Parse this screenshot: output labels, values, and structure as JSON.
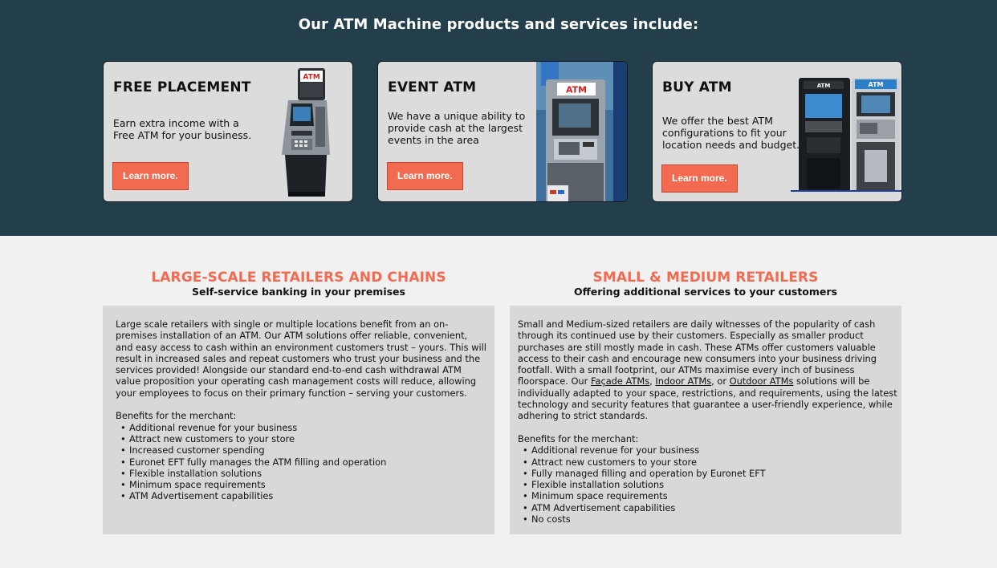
{
  "banner": {
    "heading": "Our ATM Machine products and services include:"
  },
  "cards": [
    {
      "title": "FREE PLACEMENT",
      "description": "Earn extra income with a Free ATM for your business.",
      "button": "Learn more.",
      "image_label": "ATM"
    },
    {
      "title": "EVENT ATM",
      "description": "We have a unique ability to provide cash at the largest events in the area",
      "button": "Learn more.",
      "image_label": "ATM"
    },
    {
      "title": "BUY ATM",
      "description": "We offer the best ATM configurations  to fit your location needs and budget.",
      "button": "Learn more.",
      "image_label_1": "ATM",
      "image_label_2": "ATM"
    }
  ],
  "large": {
    "title": "LARGE-SCALE RETAILERS AND CHAINS",
    "subtitle": "Self-service banking in your premises",
    "paragraph": "Large scale retailers with single or multiple locations benefit from an on-premises installation of an ATM. Our ATM solutions offer reliable, convenient, and easy access to cash within an environment customers trust – yours. This will result in increased sales and repeat customers who trust your business and the services provided! Alongside our standard end-to-end cash withdrawal ATM value proposition your operating cash management costs will reduce, allowing your employees to focus on their primary function – serving your  customers.",
    "benefits_heading": "Benefits for the merchant:",
    "benefits": [
      "Additional revenue for your business",
      "Attract new customers to your store",
      "Increased customer spending",
      "Euronet EFT fully manages the ATM filling and operation",
      "Flexible installation solutions",
      "Minimum space requirements",
      "ATM Advertisement capabilities"
    ]
  },
  "small": {
    "title": "SMALL & MEDIUM RETAILERS",
    "subtitle": "Offering additional services to your customers",
    "paragraph_start": "Small and Medium-sized retailers are daily witnesses of the popularity of cash through its continued use by their customers. Especially as smaller product purchases are still mostly made in cash. These ATMs offer customers valuable access to their cash and encourage new consumers into your business driving footfall. With a small footprint, our ATMs maximise every inch of business floorspace. Our ",
    "link_facade": "Façade ATMs",
    "sep_1": ", ",
    "link_indoor": "Indoor ATMs",
    "sep_2": ", or ",
    "link_outdoor": "Outdoor ATMs",
    "paragraph_end": " solutions will be individually adapted to your space, restrictions, and requirements, using the latest technology and security features that guarantee a user-friendly experience, while adhering to strict standards.",
    "benefits_heading": "Benefits for the merchant:",
    "benefits": [
      "Additional revenue for your business",
      "Attract new customers to your store",
      "Fully managed filling and operation by Euronet EFT",
      "Flexible installation solutions",
      "Minimum space requirements",
      "ATM Advertisement capabilities",
      "No costs"
    ]
  },
  "colors": {
    "banner_bg": "#233f4c",
    "accent": "#f26a4f",
    "card_bg": "#dcdcdc",
    "page_bg": "#f1f1f1",
    "box_bg": "#d8d8d8"
  }
}
